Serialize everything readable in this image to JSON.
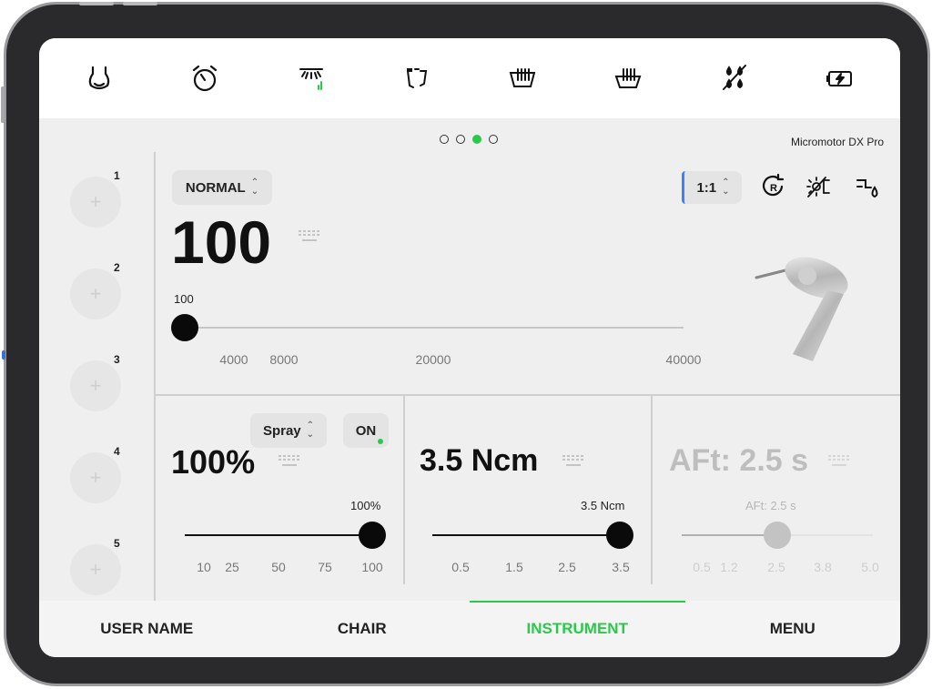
{
  "device_name": "Micromotor DX Pro",
  "top_icons": [
    "light-icon",
    "timer-icon",
    "lamp-icon",
    "frame-icon",
    "warm-basin-icon",
    "basin-icon",
    "no-water-icon",
    "battery-icon"
  ],
  "pagination": {
    "count": 4,
    "active": 3
  },
  "presets": [
    "1",
    "2",
    "3",
    "4",
    "5"
  ],
  "speed": {
    "mode": "NORMAL",
    "value": "100",
    "slider_label": "100",
    "ratio": "1:1",
    "ticks": [
      "4000",
      "8000",
      "20000",
      "40000"
    ],
    "level": 0
  },
  "spray": {
    "mode": "Spray",
    "toggle": "ON",
    "value": "100%",
    "slider_label": "100%",
    "ticks": [
      "10",
      "25",
      "50",
      "75",
      "100"
    ],
    "level": 1.0
  },
  "torque": {
    "value": "3.5 Ncm",
    "slider_label": "3.5 Ncm",
    "ticks": [
      "0.5",
      "1.5",
      "2.5",
      "3.5"
    ],
    "level": 1.0
  },
  "aft": {
    "value": "AFt: 2.5 s",
    "slider_label": "AFt: 2.5 s",
    "ticks": [
      "0.5",
      "1.2",
      "2.5",
      "3.8",
      "5.0"
    ],
    "level": 0.5
  },
  "bottom_nav": [
    "USER NAME",
    "CHAIR",
    "INSTRUMENT",
    "MENU"
  ],
  "bottom_active": "INSTRUMENT",
  "colors": {
    "accent": "#2bc94a"
  }
}
